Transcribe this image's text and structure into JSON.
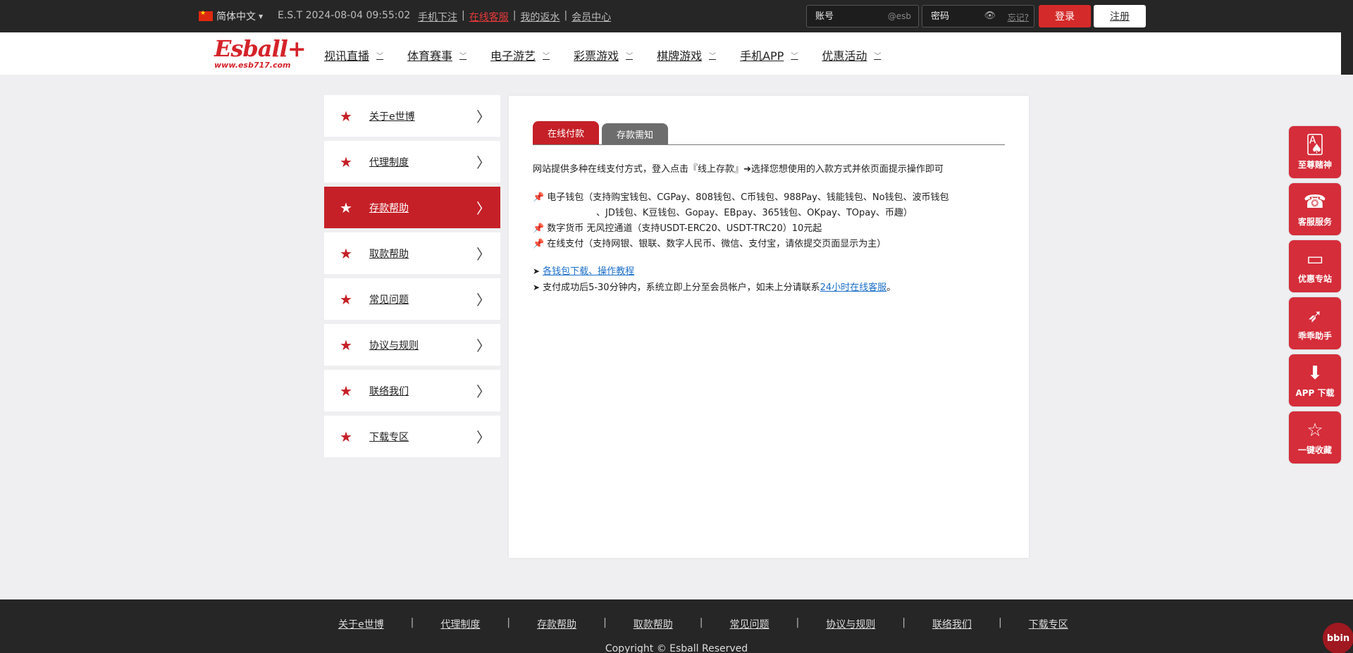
{
  "topbar": {
    "language": "简体中文",
    "time": "E.S.T 2024-08-04 09:55:02",
    "links": [
      "手机下注",
      "在线客服",
      "我的返水",
      "会员中心"
    ],
    "account_placeholder": "账号",
    "account_suffix": "@esb",
    "password_placeholder": "密码",
    "forgot": "忘记?",
    "login_label": "登录",
    "register_label": "注册"
  },
  "logo": {
    "main": "Esball+",
    "sub": "www.esb717.com"
  },
  "nav": [
    "视讯直播",
    "体育赛事",
    "电子游艺",
    "彩票游戏",
    "棋牌游戏",
    "手机APP",
    "优惠活动"
  ],
  "sidebar": {
    "items": [
      "关于e世博",
      "代理制度",
      "存款帮助",
      "取款帮助",
      "常见问题",
      "协议与规则",
      "联络我们",
      "下载专区"
    ],
    "active_index": 2
  },
  "main": {
    "tabs": [
      "在线付款",
      "存款需知"
    ],
    "intro": "网站提供多种在线支付方式，登入点击『线上存款』➜选择您想使用的入款方式并依页面提示操作即可",
    "payments": [
      {
        "line1": "电子钱包（支持购宝钱包、CGPay、808钱包、C币钱包、988Pay、钱能钱包、No钱包、波币钱包",
        "line2": "、JD钱包、K豆钱包、Gopay、EBpay、365钱包、OKpay、TOpay、币趣）"
      },
      {
        "line1": "数字货币 无风控通道（支持USDT-ERC20、USDT-TRC20）10元起"
      },
      {
        "line1": "在线支付（支持网银、银联、数字人民币、微信、支付宝，请依提交页面显示为主）"
      }
    ],
    "tutorial_link": "各钱包下载、操作教程",
    "note_prefix": "支付成功后5-30分钟内，系统立即上分至会员帐户，如未上分请联系",
    "note_link": "24小时在线客服",
    "note_suffix": "。"
  },
  "float_buttons": [
    {
      "label": "至尊赌神",
      "icon": "poker-card-icon"
    },
    {
      "label": "客服服务",
      "icon": "headset-icon"
    },
    {
      "label": "优惠专站",
      "icon": "monitor-e-icon"
    },
    {
      "label": "乖乖助手",
      "icon": "rocket-icon"
    },
    {
      "label": "APP 下载",
      "icon": "phone-download-icon"
    },
    {
      "label": "一键收藏",
      "icon": "bookmark-star-icon"
    }
  ],
  "footer": {
    "links": [
      "关于e世博",
      "代理制度",
      "存款帮助",
      "取款帮助",
      "常见问题",
      "协议与规则",
      "联络我们",
      "下载专区"
    ],
    "copyright": "Copyright © Esball Reserved"
  },
  "bbin_badge": "bbin",
  "colors": {
    "brand_red": "#c52027",
    "topbar_bg": "#262626",
    "link_blue": "#1a6fc9"
  }
}
